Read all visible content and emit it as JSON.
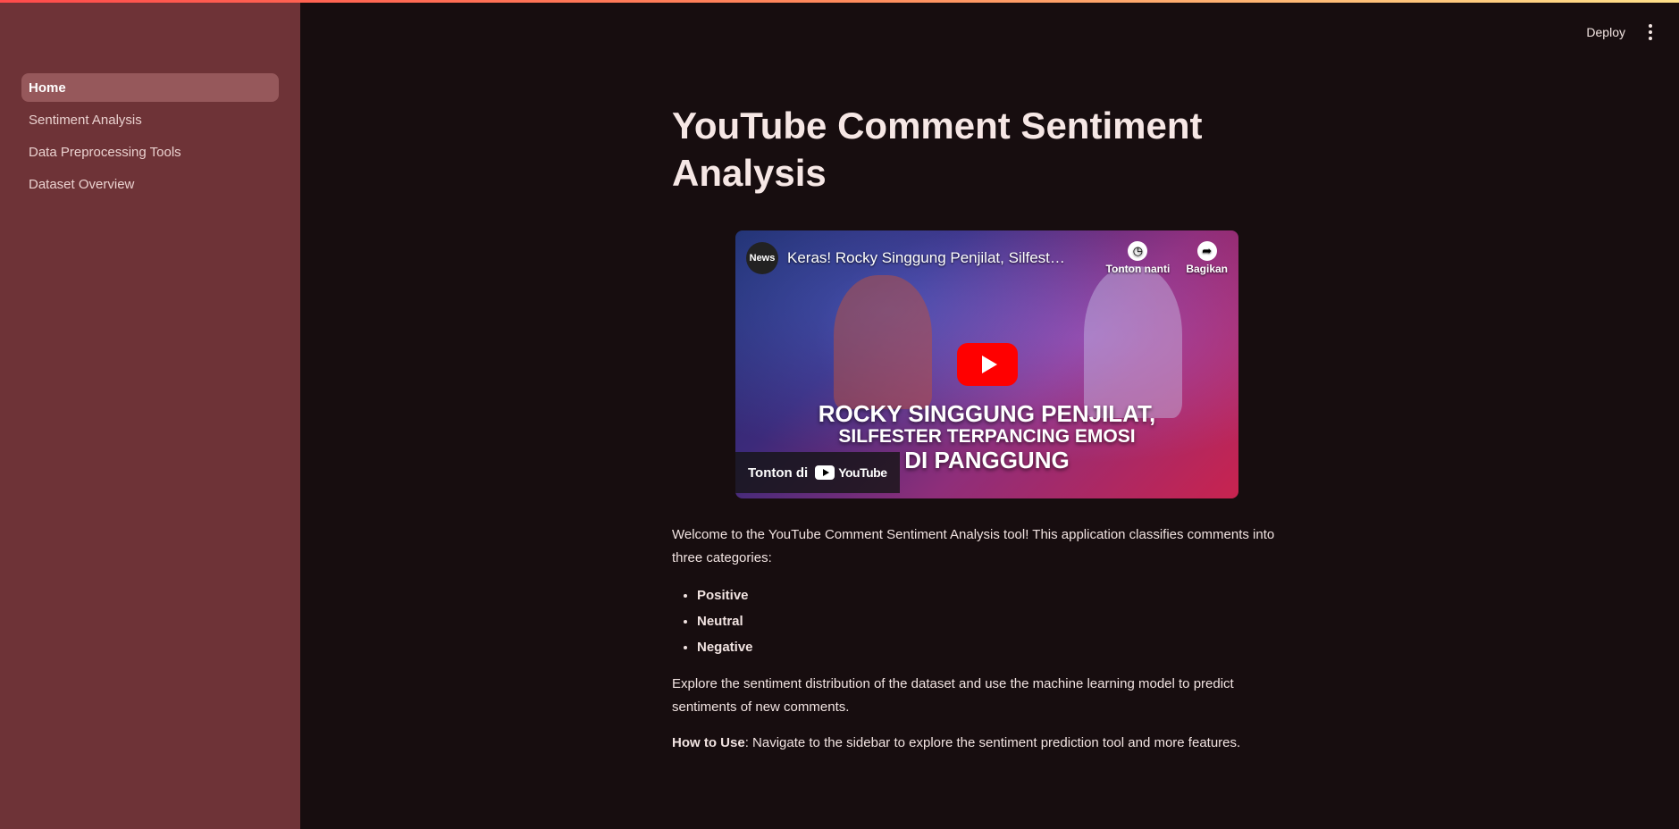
{
  "sidebar": {
    "items": [
      {
        "label": "Home",
        "active": true
      },
      {
        "label": "Sentiment Analysis",
        "active": false
      },
      {
        "label": "Data Preprocessing Tools",
        "active": false
      },
      {
        "label": "Dataset Overview",
        "active": false
      }
    ]
  },
  "header": {
    "deploy_label": "Deploy",
    "menu_icon": "kebab-menu-icon"
  },
  "main": {
    "title": "YouTube Comment Sentiment Analysis",
    "video": {
      "channel_badge": "News",
      "title": "Keras! Rocky Singgung Penjilat, Silfest…",
      "watch_later_label": "Tonton nanti",
      "share_label": "Bagikan",
      "headline_line1": "ROCKY SINGGUNG PENJILAT,",
      "headline_line2": "SILFESTER TERPANCING EMOSI",
      "headline_line3": "DI PANGGUNG",
      "watch_on_label": "Tonton di",
      "youtube_label": "YouTube"
    },
    "intro": "Welcome to the YouTube Comment Sentiment Analysis tool! This application classifies comments into three categories:",
    "categories": [
      "Positive",
      "Neutral",
      "Negative"
    ],
    "explore": "Explore the sentiment distribution of the dataset and use the machine learning model to predict sentiments of new comments.",
    "how_to_label": "How to Use",
    "how_to_text": ": Navigate to the sidebar to explore the sentiment prediction tool and more features."
  },
  "colors": {
    "sidebar_bg": "#6e3337",
    "main_bg": "#170d0f",
    "active_item_bg": "#96585b",
    "youtube_red": "#ff0000"
  }
}
